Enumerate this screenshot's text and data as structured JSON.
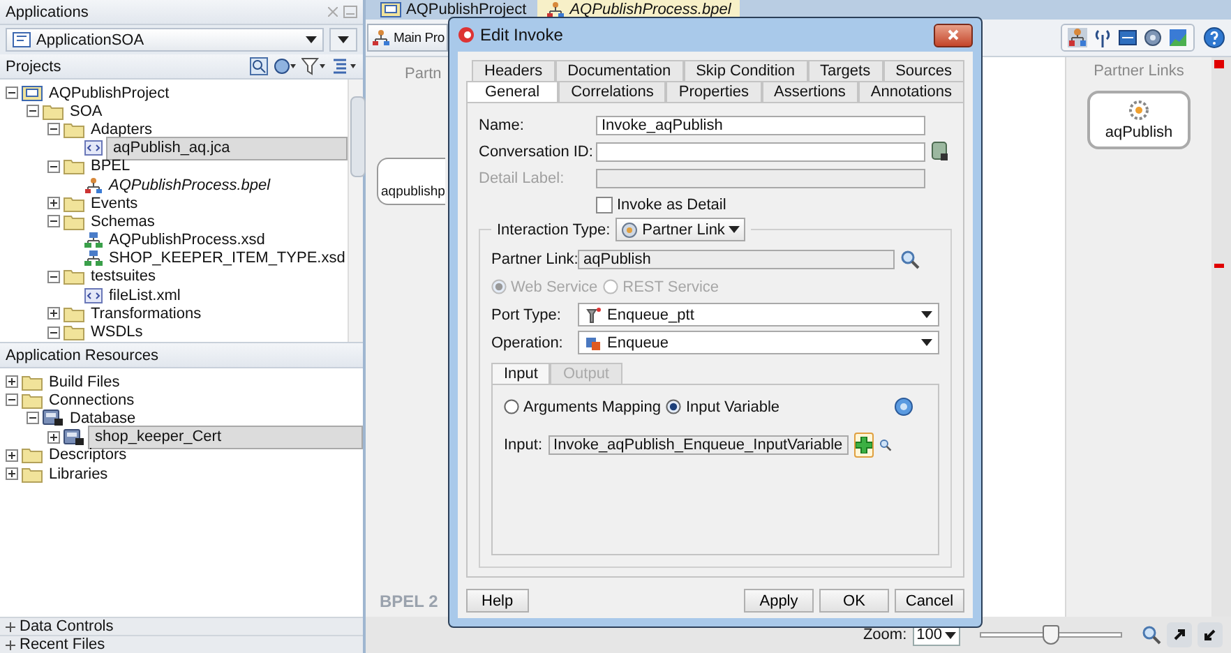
{
  "applications_panel": {
    "title": "Applications",
    "application": "ApplicationSOA"
  },
  "projects": {
    "title": "Projects",
    "tree": [
      {
        "label": "AQPublishProject",
        "kind": "project",
        "expanded": true,
        "selected": false,
        "italic": false,
        "children": [
          {
            "label": "SOA",
            "kind": "folder",
            "expanded": true,
            "selected": false,
            "italic": false,
            "children": [
              {
                "label": "Adapters",
                "kind": "folder",
                "expanded": true,
                "selected": false,
                "italic": false,
                "children": [
                  {
                    "label": "aqPublish_aq.jca",
                    "kind": "xml",
                    "selected": true,
                    "italic": false
                  }
                ]
              },
              {
                "label": "BPEL",
                "kind": "folder",
                "expanded": true,
                "selected": false,
                "italic": false,
                "children": [
                  {
                    "label": "AQPublishProcess.bpel",
                    "kind": "bpel",
                    "selected": false,
                    "italic": true
                  }
                ]
              },
              {
                "label": "Events",
                "kind": "folder",
                "expanded": false,
                "selected": false,
                "italic": false
              },
              {
                "label": "Schemas",
                "kind": "folder",
                "expanded": true,
                "selected": false,
                "italic": false,
                "children": [
                  {
                    "label": "AQPublishProcess.xsd",
                    "kind": "xsd",
                    "selected": false,
                    "italic": false
                  },
                  {
                    "label": "SHOP_KEEPER_ITEM_TYPE.xsd",
                    "kind": "xsd",
                    "selected": false,
                    "italic": false
                  }
                ]
              },
              {
                "label": "testsuites",
                "kind": "folder",
                "expanded": true,
                "selected": false,
                "italic": false,
                "children": [
                  {
                    "label": "fileList.xml",
                    "kind": "xml",
                    "selected": false,
                    "italic": false
                  }
                ]
              },
              {
                "label": "Transformations",
                "kind": "folder",
                "expanded": false,
                "selected": false,
                "italic": false
              },
              {
                "label": "WSDLs",
                "kind": "folder",
                "expanded": true,
                "selected": false,
                "italic": false
              }
            ]
          }
        ]
      }
    ]
  },
  "resources": {
    "title": "Application Resources",
    "tree": [
      {
        "label": "Build Files",
        "kind": "folder",
        "expanded": false,
        "selected": false,
        "italic": false
      },
      {
        "label": "Connections",
        "kind": "folder",
        "expanded": true,
        "selected": false,
        "italic": false,
        "children": [
          {
            "label": "Database",
            "kind": "db",
            "expanded": true,
            "selected": false,
            "italic": false,
            "children": [
              {
                "label": "shop_keeper_Cert",
                "kind": "db",
                "expanded": false,
                "selected": true,
                "italic": false
              }
            ]
          }
        ]
      },
      {
        "label": "Descriptors",
        "kind": "folder",
        "expanded": false,
        "selected": false,
        "italic": false
      },
      {
        "label": "Libraries",
        "kind": "folder",
        "expanded": false,
        "selected": false,
        "italic": false
      }
    ]
  },
  "collapsed_panels": [
    "Data Controls",
    "Recent Files"
  ],
  "editor": {
    "tabs": [
      {
        "label": "AQPublishProject",
        "kind": "project",
        "selected": false
      },
      {
        "label": "AQPublishProcess.bpel",
        "kind": "bpel",
        "selected": true
      }
    ],
    "view_button": "Main Pro",
    "canvas_column": "Partn",
    "canvas_node": "aqpublishp",
    "canvas_label": "BPEL 2",
    "partner_links": {
      "title": "Partner Links",
      "items": [
        "aqPublish"
      ]
    },
    "zoom": {
      "label": "Zoom:",
      "value": "100",
      "level": 0.5
    }
  },
  "dialog": {
    "title": "Edit Invoke",
    "tabs_back": [
      {
        "label": "Headers",
        "selected": false
      },
      {
        "label": "Documentation",
        "selected": false
      },
      {
        "label": "Skip Condition",
        "selected": false
      },
      {
        "label": "Targets",
        "selected": false
      },
      {
        "label": "Sources",
        "selected": false
      }
    ],
    "tabs_front": [
      {
        "label": "General",
        "selected": true
      },
      {
        "label": "Correlations",
        "selected": false
      },
      {
        "label": "Properties",
        "selected": false
      },
      {
        "label": "Assertions",
        "selected": false
      },
      {
        "label": "Annotations",
        "selected": false
      }
    ],
    "name": {
      "label": "Name:",
      "value": "Invoke_aqPublish"
    },
    "conversation_id": {
      "label": "Conversation ID:"
    },
    "detail_label": {
      "label": "Detail Label:",
      "disabled": true
    },
    "invoke_as_detail": {
      "label": "Invoke as Detail",
      "checked": false
    },
    "interaction_type": {
      "label": "Interaction Type:",
      "value": "Partner Link"
    },
    "partner_link": {
      "label": "Partner Link:",
      "value": "aqPublish"
    },
    "service_kind": [
      {
        "label": "Web Service",
        "selected": true,
        "disabled": true
      },
      {
        "label": "REST Service",
        "selected": false,
        "disabled": true
      }
    ],
    "port_type": {
      "label": "Port Type:",
      "value": "Enqueue_ptt"
    },
    "operation": {
      "label": "Operation:",
      "value": "Enqueue"
    },
    "io_tabs": [
      {
        "label": "Input",
        "selected": true,
        "disabled": false
      },
      {
        "label": "Output",
        "selected": false,
        "disabled": true
      }
    ],
    "mapping": [
      {
        "label": "Arguments Mapping",
        "selected": false
      },
      {
        "label": "Input Variable",
        "selected": true
      }
    ],
    "input": {
      "label": "Input:",
      "value": "Invoke_aqPublish_Enqueue_InputVariable"
    },
    "buttons": [
      "Help",
      "Apply",
      "OK",
      "Cancel"
    ]
  }
}
